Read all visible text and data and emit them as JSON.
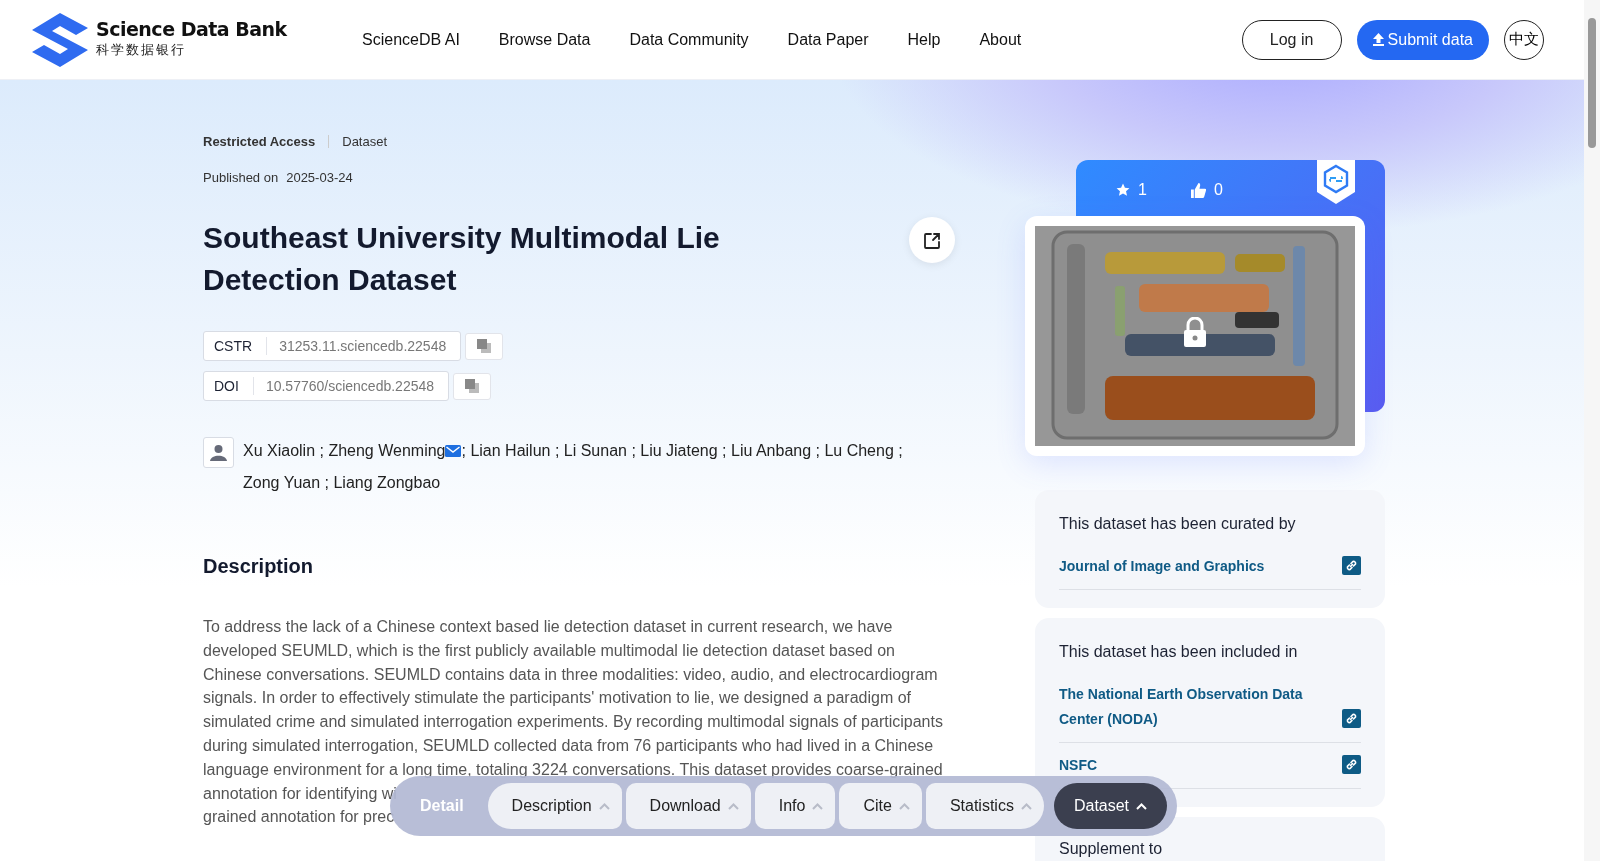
{
  "header": {
    "logo_title": "Science Data Bank",
    "logo_subtitle": "科学数据银行",
    "nav": [
      "ScienceDB AI",
      "Browse Data",
      "Data Community",
      "Data Paper",
      "Help",
      "About"
    ],
    "login": "Log in",
    "submit": "Submit data",
    "language": "中文"
  },
  "dataset": {
    "access": "Restricted Access",
    "type": "Dataset",
    "published_label": "Published on",
    "published_date": "2025-03-24",
    "title": "Southeast University Multimodal Lie Detection Dataset",
    "identifiers": [
      {
        "label": "CSTR",
        "value": "31253.11.sciencedb.22548"
      },
      {
        "label": "DOI",
        "value": "10.57760/sciencedb.22548"
      }
    ],
    "authors": [
      {
        "text": "Xu Xiaolin ; Zheng Wenming",
        "email": true
      },
      {
        "text": "; Lian Hailun ; Li Sunan ; Liu Jiateng ; Liu Anbang ; Lu Cheng ;",
        "email": false
      },
      {
        "text": "Zong Yuan ; Liang Zongbao",
        "email": false
      }
    ],
    "description_heading": "Description",
    "description_lines": [
      "To address the lack of a Chinese context based lie detection dataset in current research, we have",
      "developed SEUMLD, which is the first publicly available multimodal lie detection dataset based on",
      "Chinese conversations. SEUMLD contains data in three modalities: video, audio, and electrocardiogram",
      "signals. In order to effectively stimulate the participants' motivation to lie, we designed a paradigm of",
      "simulated crime and simulated interrogation experiments. By recording multimodal signals of participants",
      "during simulated interrogation, SEUMLD collected data from 76 participants who had lived in a Chinese",
      "language environment for a long time, totaling 3224 conversations. This dataset provides coarse-grained",
      "annotation for identifying wi",
      "grained annotation for prec"
    ]
  },
  "sidebar": {
    "stars": "1",
    "likes": "0",
    "cover": {
      "kind": "picture",
      "locked": true
    },
    "panels": [
      {
        "heading": "This dataset has been curated by",
        "links": [
          "Journal of Image and Graphics"
        ]
      },
      {
        "heading": "This dataset has been included in",
        "links": [
          "The National Earth Observation Data Center (NODA)",
          "NSFC"
        ]
      },
      {
        "heading": "Supplement to"
      }
    ]
  },
  "section_bar": {
    "label": "Detail",
    "tabs": [
      {
        "label": "Description",
        "selected": false
      },
      {
        "label": "Download",
        "selected": false
      },
      {
        "label": "Info",
        "selected": false
      },
      {
        "label": "Cite",
        "selected": false
      },
      {
        "label": "Statistics",
        "selected": false
      },
      {
        "label": "Dataset",
        "selected": true
      }
    ]
  }
}
